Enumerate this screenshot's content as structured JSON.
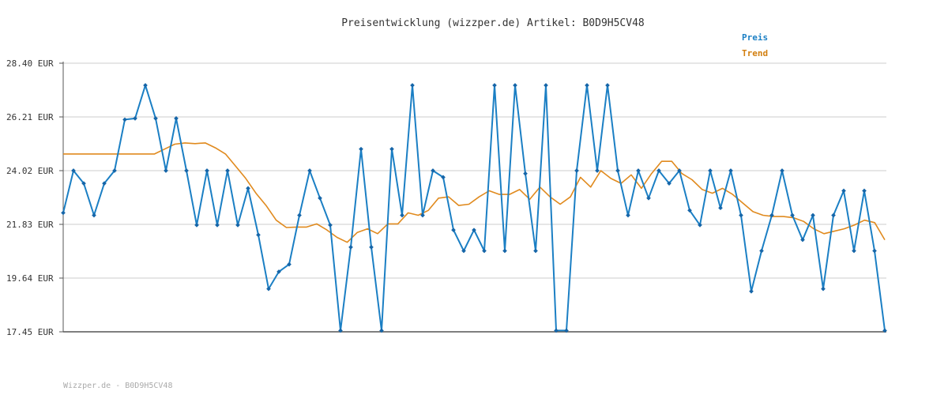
{
  "chart_data": {
    "type": "line",
    "title": "Preisentwicklung (wizzper.de) Artikel: B0D9H5CV48",
    "footer": "Wizzper.de - B0D9H5CV48",
    "yticks": [
      "28.40 EUR",
      "26.21 EUR",
      "24.02 EUR",
      "21.83 EUR",
      "19.64 EUR",
      "17.45 EUR"
    ],
    "ylim": [
      17.45,
      28.4
    ],
    "grid": true,
    "legend_position": "top-right",
    "colors": {
      "preis": "#1b7fc4",
      "trend": "#e08a1e",
      "preis_label": "#1b7fc4",
      "trend_label": "#d27f10"
    },
    "series": [
      {
        "name": "Preis",
        "values": [
          22.3,
          24.02,
          23.5,
          22.2,
          23.5,
          24.02,
          26.1,
          26.15,
          27.5,
          26.15,
          24.02,
          26.15,
          24.02,
          21.8,
          24.02,
          21.8,
          24.02,
          21.8,
          23.3,
          21.4,
          19.2,
          19.9,
          20.2,
          22.2,
          24.02,
          22.9,
          21.8,
          17.5,
          20.9,
          24.9,
          20.9,
          17.5,
          24.9,
          22.2,
          27.5,
          22.2,
          24.02,
          23.75,
          21.6,
          20.75,
          21.6,
          20.75,
          27.5,
          20.75,
          27.5,
          23.9,
          20.75,
          27.5,
          17.5,
          17.5,
          24.02,
          27.5,
          24.02,
          27.5,
          24.02,
          22.2,
          24.02,
          22.9,
          24.02,
          23.5,
          24.02,
          22.4,
          21.8,
          24.02,
          22.5,
          24.02,
          22.2,
          19.1,
          20.75,
          22.2,
          24.02,
          22.2,
          21.2,
          22.2,
          19.2,
          22.2,
          23.2,
          20.75,
          23.2,
          20.75,
          17.5
        ],
        "x_start": "",
        "note": ""
      },
      {
        "name": "Trend",
        "values": [
          24.7,
          24.7,
          24.7,
          24.7,
          24.7,
          24.7,
          24.7,
          24.7,
          24.7,
          24.7,
          24.9,
          25.1,
          25.15,
          25.12,
          25.15,
          24.95,
          24.7,
          24.2,
          23.7,
          23.1,
          22.6,
          22.0,
          21.7,
          21.72,
          21.72,
          21.85,
          21.6,
          21.3,
          21.1,
          21.5,
          21.65,
          21.45,
          21.85,
          21.85,
          22.3,
          22.2,
          22.4,
          22.9,
          22.95,
          22.6,
          22.65,
          22.95,
          23.2,
          23.05,
          23.05,
          23.25,
          22.85,
          23.35,
          22.95,
          22.65,
          22.95,
          23.75,
          23.35,
          24.02,
          23.7,
          23.5,
          23.85,
          23.3,
          23.9,
          24.4,
          24.4,
          23.9,
          23.65,
          23.25,
          23.1,
          23.3,
          23.05,
          22.7,
          22.35,
          22.2,
          22.15,
          22.15,
          22.1,
          21.95,
          21.65,
          21.45,
          21.55,
          21.65,
          21.8,
          22.0,
          21.9,
          21.2
        ]
      }
    ]
  }
}
